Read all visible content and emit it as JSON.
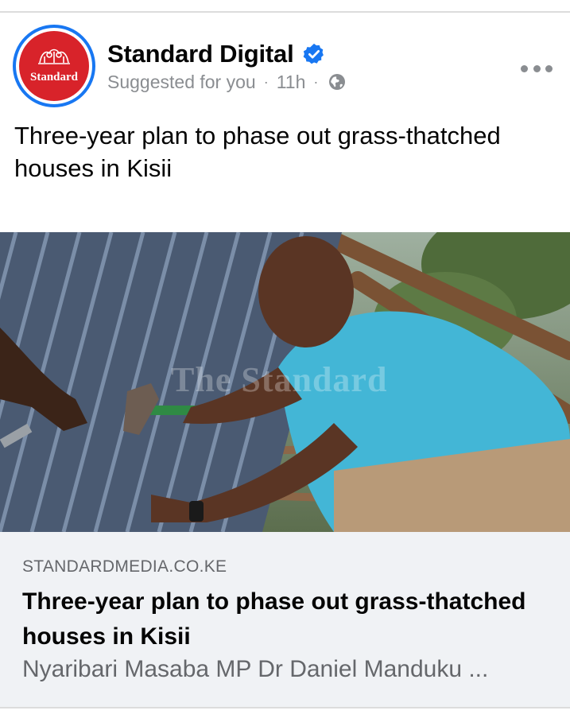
{
  "post": {
    "page_name": "Standard Digital",
    "avatar_text": "Standard",
    "meta": {
      "suggested": "Suggested for you",
      "separator": "·",
      "time": "11h"
    },
    "text": "Three-year plan to phase out grass-thatched houses in Kisii",
    "photo_watermark": "The Standard",
    "link": {
      "domain": "STANDARDMEDIA.CO.KE",
      "title": "Three-year plan to phase out grass-thatched houses in Kisii",
      "description": "Nyaribari Masaba MP Dr Daniel Manduku ..."
    }
  },
  "icons": {
    "verified": "verified-badge-icon",
    "audience": "globe-icon",
    "more": "more-options-icon"
  },
  "colors": {
    "accent": "#1877f2",
    "brand": "#d8232a",
    "secondary_text": "#65676b",
    "link_background": "#f0f2f5"
  }
}
